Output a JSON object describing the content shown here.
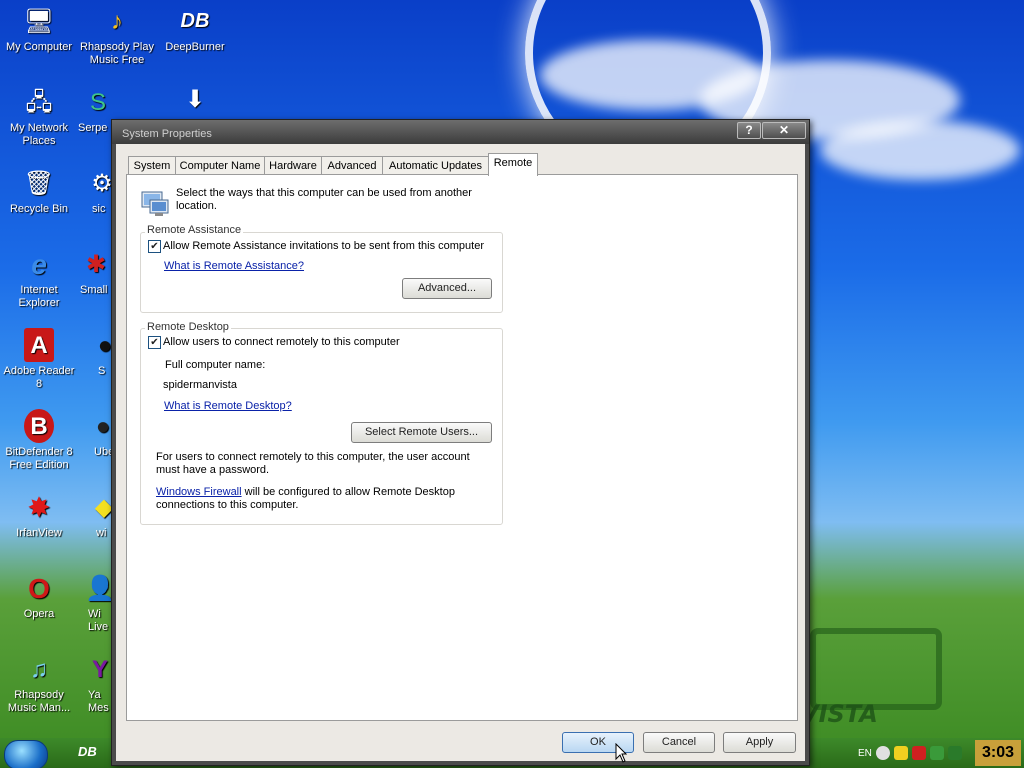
{
  "desktop": {
    "icons": [
      {
        "label": "My Computer",
        "glyph": "🖥"
      },
      {
        "label": "Rhapsody Play Music Free",
        "glyph": "♪"
      },
      {
        "label": "DeepBurner",
        "glyph": "DB"
      },
      {
        "label": "My Network Places",
        "glyph": "🖧"
      },
      {
        "label": "Serpe",
        "glyph": "S"
      },
      {
        "label": "",
        "glyph": "⬇"
      },
      {
        "label": "Recycle Bin",
        "glyph": "🗑"
      },
      {
        "label": "sic",
        "glyph": "⚙"
      },
      {
        "label": "Internet Explorer",
        "glyph": "e"
      },
      {
        "label": "Small",
        "glyph": "✱"
      },
      {
        "label": "Adobe Reader 8",
        "glyph": "A"
      },
      {
        "label": "S",
        "glyph": "●"
      },
      {
        "label": "BitDefender 8 Free Edition",
        "glyph": "B"
      },
      {
        "label": "Ube",
        "glyph": "●"
      },
      {
        "label": "IrfanView",
        "glyph": "✸"
      },
      {
        "label": "wi",
        "glyph": "◆"
      },
      {
        "label": "Opera",
        "glyph": "O"
      },
      {
        "label": "Wi Live",
        "glyph": "👤"
      },
      {
        "label": "Rhapsody Music Man...",
        "glyph": "♫"
      },
      {
        "label": "Ya Mes",
        "glyph": "Y"
      }
    ]
  },
  "taskbar": {
    "quicklaunch": "DB",
    "language": "EN",
    "clock": "3:03"
  },
  "window": {
    "title": "System Properties",
    "help_btn": "?",
    "close_btn": "✕",
    "tabs": [
      {
        "label": "System"
      },
      {
        "label": "Computer Name"
      },
      {
        "label": "Hardware"
      },
      {
        "label": "Advanced"
      },
      {
        "label": "Automatic Updates"
      },
      {
        "label": "Remote"
      }
    ],
    "active_tab": "Remote",
    "intro": "Select the ways that this computer can be used from another location.",
    "remote_assistance": {
      "group_label": "Remote Assistance",
      "checkbox_label": "Allow Remote Assistance invitations to be sent from this computer",
      "checked": true,
      "link": "What is Remote Assistance?",
      "advanced_btn": "Advanced..."
    },
    "remote_desktop": {
      "group_label": "Remote Desktop",
      "checkbox_label": "Allow users to connect remotely to this computer",
      "checked": true,
      "full_name_label": "Full computer name:",
      "full_name_value": "spidermanvista",
      "link": "What is Remote Desktop?",
      "select_users_btn": "Select Remote Users...",
      "note_password": "For users to connect remotely to this computer, the user account must have a password.",
      "firewall_link": "Windows Firewall",
      "firewall_text": "will be configured to allow Remote Desktop connections to this computer."
    },
    "buttons": {
      "ok": "OK",
      "cancel": "Cancel",
      "apply": "Apply"
    }
  }
}
